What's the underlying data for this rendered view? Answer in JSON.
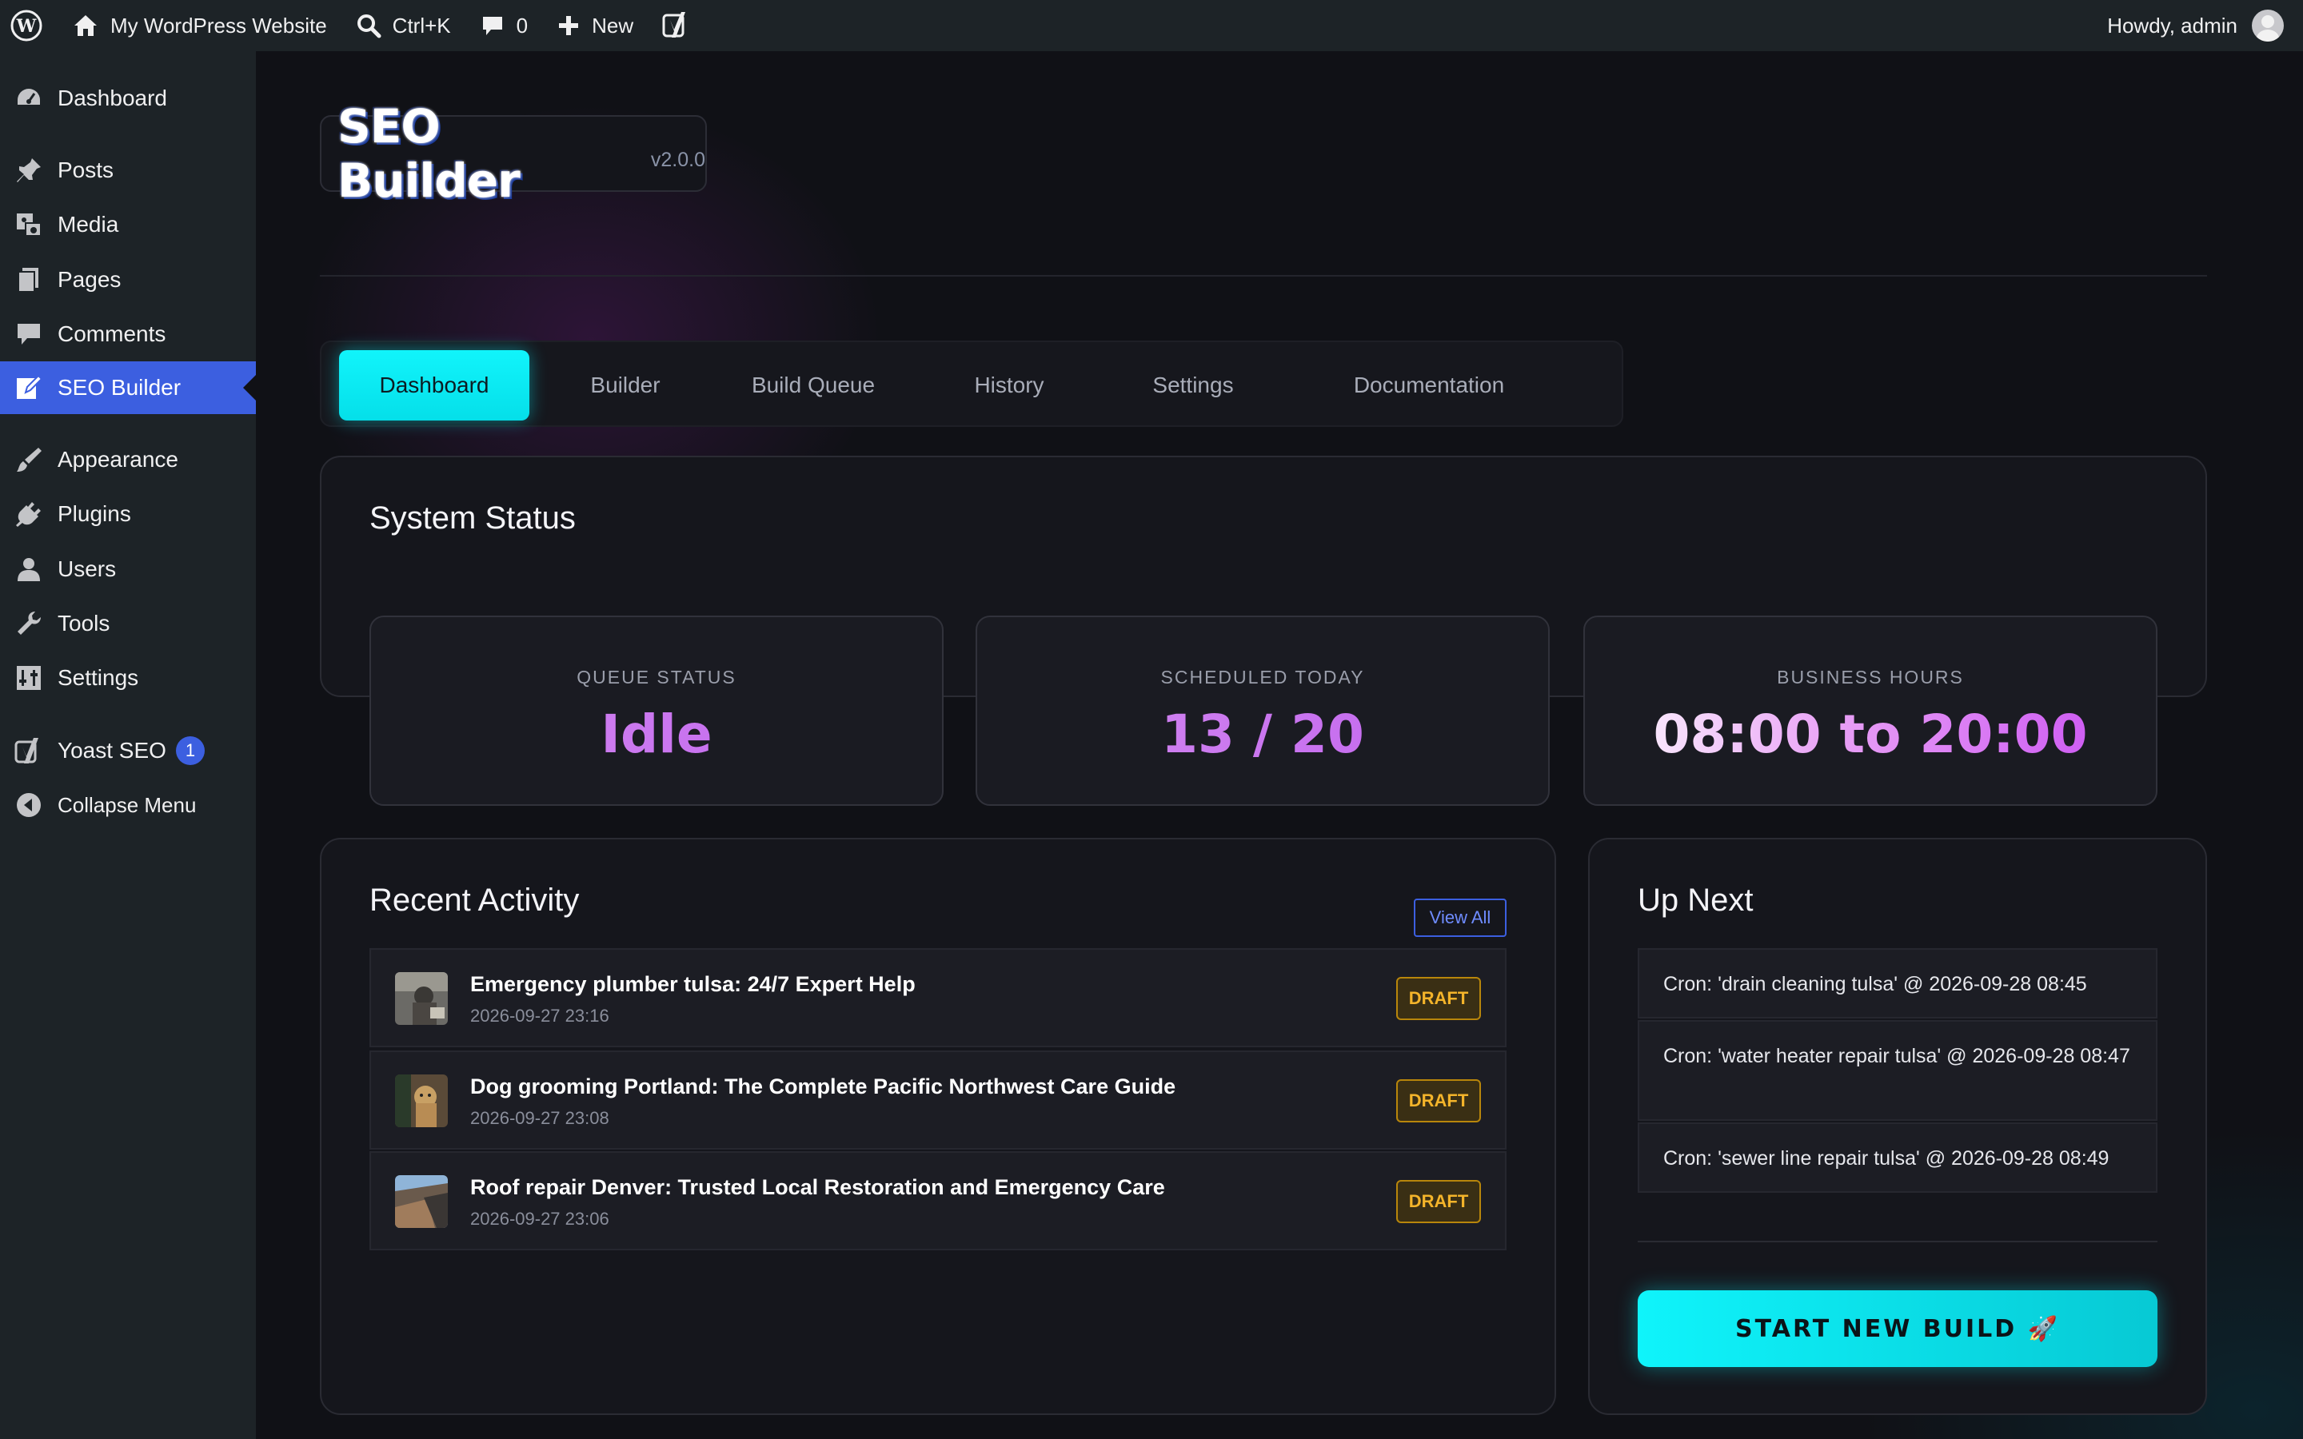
{
  "adminbar": {
    "site_name": "My WordPress Website",
    "search_shortcut": "Ctrl+K",
    "comments_count": "0",
    "new_label": "New",
    "greeting": "Howdy, admin"
  },
  "sidebar": {
    "items": [
      {
        "label": "Dashboard",
        "icon": "dashboard-icon"
      },
      {
        "label": "Posts",
        "icon": "pin-icon"
      },
      {
        "label": "Media",
        "icon": "media-icon"
      },
      {
        "label": "Pages",
        "icon": "pages-icon"
      },
      {
        "label": "Comments",
        "icon": "comment-icon"
      },
      {
        "label": "SEO Builder",
        "icon": "edit-icon"
      },
      {
        "label": "Appearance",
        "icon": "brush-icon"
      },
      {
        "label": "Plugins",
        "icon": "plug-icon"
      },
      {
        "label": "Users",
        "icon": "user-icon"
      },
      {
        "label": "Tools",
        "icon": "wrench-icon"
      },
      {
        "label": "Settings",
        "icon": "settings-icon"
      },
      {
        "label": "Yoast SEO",
        "icon": "yoast-icon",
        "badge": "1"
      },
      {
        "label": "Collapse Menu",
        "icon": "collapse-icon"
      }
    ],
    "active_color": "#3c5fe0"
  },
  "header": {
    "title": "SEO Builder",
    "version": "v2.0.0"
  },
  "tabs": [
    {
      "label": "Dashboard",
      "active": true
    },
    {
      "label": "Builder"
    },
    {
      "label": "Build Queue"
    },
    {
      "label": "History"
    },
    {
      "label": "Settings"
    },
    {
      "label": "Documentation"
    }
  ],
  "system_status": {
    "title": "System Status",
    "stats": [
      {
        "label": "QUEUE STATUS",
        "value": "Idle"
      },
      {
        "label": "SCHEDULED TODAY",
        "value": "13 / 20"
      },
      {
        "label": "BUSINESS HOURS",
        "value": "08:00 to 20:00"
      }
    ]
  },
  "recent_activity": {
    "title": "Recent Activity",
    "view_all": "View All",
    "items": [
      {
        "title": "Emergency plumber tulsa: 24/7 Expert Help",
        "date": "2026-09-27 23:16",
        "status": "DRAFT"
      },
      {
        "title": "Dog grooming Portland: The Complete Pacific Northwest Care Guide",
        "date": "2026-09-27 23:08",
        "status": "DRAFT"
      },
      {
        "title": "Roof repair Denver: Trusted Local Restoration and Emergency Care",
        "date": "2026-09-27 23:06",
        "status": "DRAFT"
      }
    ]
  },
  "up_next": {
    "title": "Up Next",
    "items": [
      "Cron: 'drain cleaning tulsa' @ 2026-09-28 08:45",
      "Cron: 'water heater repair tulsa' @ 2026-09-28 08:47",
      "Cron: 'sewer line repair tulsa' @ 2026-09-28 08:49"
    ],
    "button": "START NEW BUILD 🚀"
  },
  "colors": {
    "accent_cyan": "#0ff0f8",
    "draft_amber": "#f4b42a",
    "stat_purple": "#c84df2"
  }
}
